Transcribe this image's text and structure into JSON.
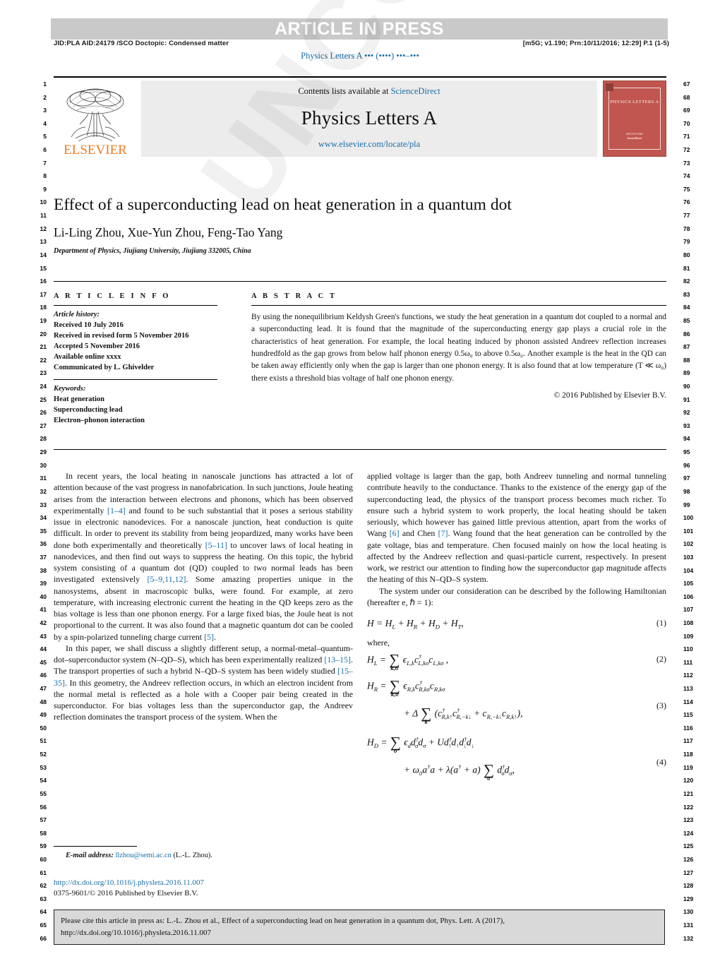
{
  "header": {
    "banner": "ARTICLE IN PRESS",
    "jid_left": "JID:PLA    AID:24179 /SCO    Doctopic: Condensed matter",
    "jid_right": "[m5G; v1.190; Prn:10/11/2016; 12:29] P.1 (1-5)",
    "running_head": "Physics Letters A ••• (••••) •••–•••"
  },
  "masthead": {
    "contents_prefix": "Contents lists available at ",
    "sciencedirect": "ScienceDirect",
    "journal_name": "Physics Letters A",
    "journal_url": "www.elsevier.com/locate/pla",
    "publisher": "ELSEVIER",
    "cover_title": "PHYSICS LETTERS A",
    "cover_footer": "ISSN 0375-9601\nAvailable online at\nScienceDirect"
  },
  "article": {
    "title": "Effect of a superconducting lead on heat generation in a quantum dot",
    "authors": "Li-Ling Zhou, Xue-Yun Zhou, Feng-Tao Yang",
    "affiliation": "Department of Physics, Jiujiang University, Jiujiang 332005, China"
  },
  "info": {
    "heading": "A R T I C L E   I N F O",
    "history_label": "Article history:",
    "history": [
      "Received 10 July 2016",
      "Received in revised form 5 November 2016",
      "Accepted 5 November 2016",
      "Available online xxxx",
      "Communicated by L. Ghivelder"
    ],
    "keywords_label": "Keywords:",
    "keywords": [
      "Heat generation",
      "Superconducting lead",
      "Electron–phonon interaction"
    ]
  },
  "abstract": {
    "heading": "A B S T R A C T",
    "text": "By using the nonequilibrium Keldysh Green's functions, we study the heat generation in a quantum dot coupled to a normal and a superconducting lead. It is found that the magnitude of the superconducting energy gap plays a crucial role in the characteristics of heat generation. For example, the local heating induced by phonon assisted Andreev reflection increases hundredfold as the gap grows from below half phonon energy 0.5ω₀ to above 0.5ω₀. Another example is the heat in the QD can be taken away efficiently only when the gap is larger than one phonon energy. It is also found that at low temperature (T ≪ ω₀) there exists a threshold bias voltage of half one phonon energy.",
    "copyright": "© 2016 Published by Elsevier B.V."
  },
  "body": {
    "left": {
      "p1_a": "In recent years, the local heating in nanoscale junctions has attracted a lot of attention because of the vast progress in nanofabrication. In such junctions, Joule heating arises from the interaction between electrons and phonons, which has been observed experimentally ",
      "p1_r1": "[1–4]",
      "p1_b": " and found to be such substantial that it poses a serious stability issue in electronic nanodevices. For a nanoscale junction, heat conduction is quite difficult. In order to prevent its stability from being jeopardized, many works have been done both experimentally and theoretically ",
      "p1_r2": "[5–11]",
      "p1_c": " to uncover laws of local heating in nanodevices, and then find out ways to suppress the heating. On this topic, the hybrid system consisting of a quantum dot (QD) coupled to two normal leads has been investigated extensively ",
      "p1_r3": "[5–9,11,12]",
      "p1_d": ". Some amazing properties unique in the nanosystems, absent in macroscopic bulks, were found. For example, at zero temperature, with increasing electronic current the heating in the QD keeps zero as the bias voltage is less than one phonon energy. For a large fixed bias, the Joule heat is not proportional to the current. It was also found that a magnetic quantum dot can be cooled by a spin-polarized tunneling charge current ",
      "p1_r4": "[5]",
      "p1_e": ".",
      "p2_a": "In this paper, we shall discuss a slightly different setup, a normal-metal–quantum-dot–superconductor system (N–QD–S), which has been experimentally realized ",
      "p2_r1": "[13–15]",
      "p2_b": ". The transport properties of such a hybrid N–QD–S system has been widely studied ",
      "p2_r2": "[15–35]",
      "p2_c": ". In this geometry, the Andreev reflection occurs, in which an electron incident from the normal metal is reflected as a hole with a Cooper pair being created in the superconductor. For bias voltages less than the superconductor gap, the Andreev reflection dominates the transport process of the system. When the"
    },
    "right": {
      "p1_a": "applied voltage is larger than the gap, both Andreev tunneling and normal tunneling contribute heavily to the conductance. Thanks to the existence of the energy gap of the superconducting lead, the physics of the transport process becomes much richer. To ensure such a hybrid system to work properly, the local heating should be taken seriously, which however has gained little previous attention, apart from the works of Wang ",
      "p1_r1": "[6]",
      "p1_b": " and Chen ",
      "p1_r2": "[7]",
      "p1_c": ". Wang found that the heat generation can be controlled by the gate voltage, bias and temperature. Chen focused mainly on how the local heating is affected by the Andreev reflection and quasi-particle current, respectively. In present work, we restrict our attention to finding how the superconductor gap magnitude affects the heating of this N–QD–S system.",
      "p2": "The system under our consideration can be described by the following Hamiltonian (hereafter e, ℏ = 1):"
    }
  },
  "equations": {
    "eq1_num": "(1)",
    "eq1": "H = H_L + H_R + H_D + H_T ,",
    "where_label": "where,",
    "eq2_num": "(2)",
    "eq3_num": "(3)",
    "eq4_num": "(4)"
  },
  "footnote": {
    "label": "E-mail address:",
    "email": "llzhou@semi.ac.cn",
    "suffix": "(L.-L. Zhou)."
  },
  "footer": {
    "doi": "http://dx.doi.org/10.1016/j.physleta.2016.11.007",
    "issn": "0375-9601/© 2016 Published by Elsevier B.V."
  },
  "cite_box": {
    "line1": "Please cite this article in press as: L.-L. Zhou et al., Effect of a superconducting lead on heat generation in a quantum dot, Phys. Lett. A (2017),",
    "line2": "http://dx.doi.org/10.1016/j.physleta.2016.11.007"
  },
  "watermark": {
    "text": "UNCORRECTED PROOF"
  },
  "line_numbers": {
    "left_start": 1,
    "left_end": 66,
    "right_start": 67,
    "right_end": 132
  },
  "colors": {
    "link": "#1a6ea8",
    "elsevier_orange": "#ef7d22",
    "banner_grey": "#c9c9c9",
    "cite_box_grey": "#d9d9d9"
  }
}
